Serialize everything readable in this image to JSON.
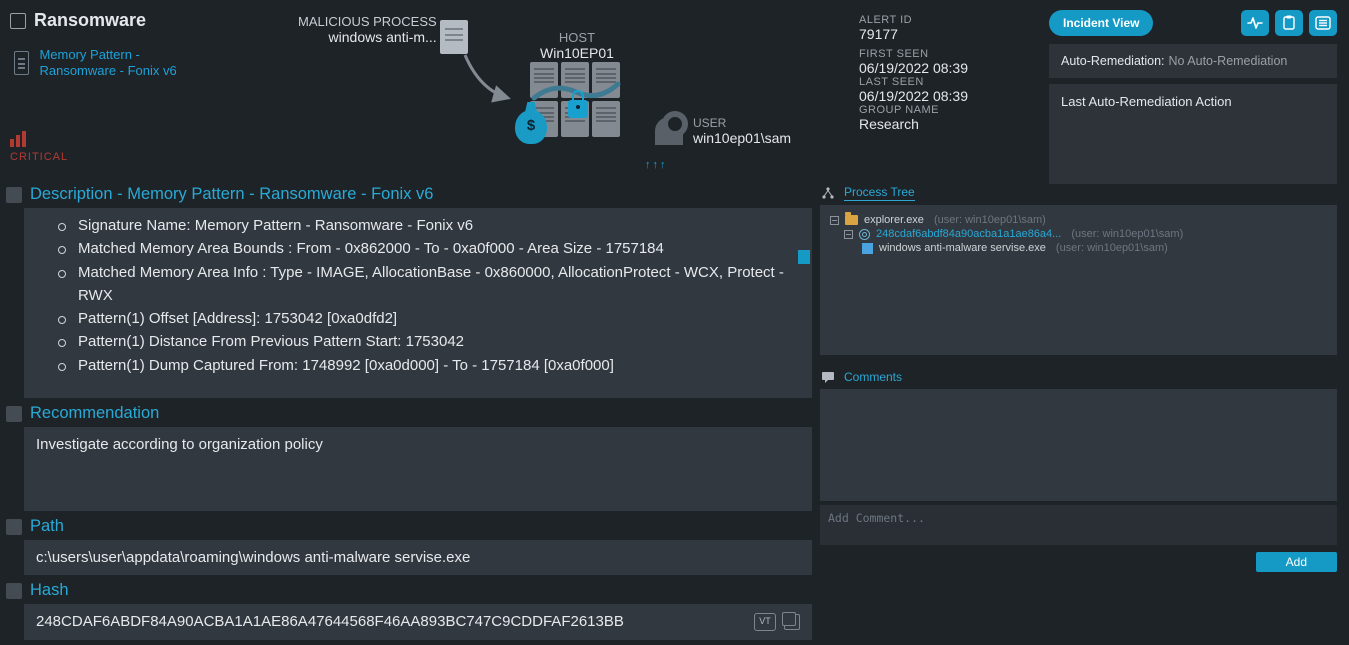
{
  "leftNav": {
    "title": "Ransomware",
    "item": "Memory Pattern - Ransomware - Fonix v6",
    "critical": "CRITICAL"
  },
  "graphic": {
    "maliciousLabel": "MALICIOUS PROCESS",
    "maliciousName": "windows anti-m...",
    "hostLabel": "HOST",
    "hostName": "Win10EP01",
    "userLabel": "USER",
    "userName": "win10ep01\\sam"
  },
  "meta": {
    "alertIdLabel": "ALERT ID",
    "alertId": "79177",
    "firstSeenLabel": "FIRST SEEN",
    "firstSeen": "06/19/2022 08:39",
    "lastSeenLabel": "LAST SEEN",
    "lastSeen": "06/19/2022 08:39",
    "groupLabel": "GROUP NAME",
    "group": "Research"
  },
  "actions": {
    "incidentView": "Incident View",
    "autoRemLabel": "Auto-Remediation:",
    "autoRemValue": "No Auto-Remediation",
    "lastAction": "Last Auto-Remediation Action"
  },
  "description": {
    "title": "Description - Memory Pattern - Ransomware - Fonix v6",
    "b1": "Signature Name: Memory Pattern - Ransomware - Fonix v6",
    "b2": "Matched Memory Area Bounds : From - 0x862000 - To - 0xa0f000 - Area Size - 1757184",
    "b3": "Matched Memory Area Info : Type - IMAGE, AllocationBase - 0x860000, AllocationProtect - WCX, Protect - RWX",
    "b4": "Pattern(1) Offset [Address]: 1753042 [0xa0dfd2]",
    "b5": "Pattern(1) Distance From Previous Pattern Start: 1753042",
    "b6": "Pattern(1) Dump Captured From: 1748992 [0xa0d000] - To - 1757184 [0xa0f000]"
  },
  "recommendation": {
    "title": "Recommendation",
    "text": "Investigate according to organization policy"
  },
  "path": {
    "title": "Path",
    "text": "c:\\users\\user\\appdata\\roaming\\windows anti-malware servise.exe"
  },
  "hash": {
    "title": "Hash",
    "text": "248CDAF6ABDF84A90ACBA1A1AE86A47644568F46AA893BC747C9CDDFAF2613BB",
    "vt": "VT"
  },
  "tree": {
    "title": "Process Tree",
    "r1name": "explorer.exe",
    "r1user": "(user: win10ep01\\sam)",
    "r2name": "248cdaf6abdf84a90acba1a1ae86a4...",
    "r2user": "(user: win10ep01\\sam)",
    "r3name": "windows anti-malware servise.exe",
    "r3user": "(user: win10ep01\\sam)"
  },
  "comments": {
    "title": "Comments",
    "placeholder": "Add Comment...",
    "add": "Add"
  }
}
